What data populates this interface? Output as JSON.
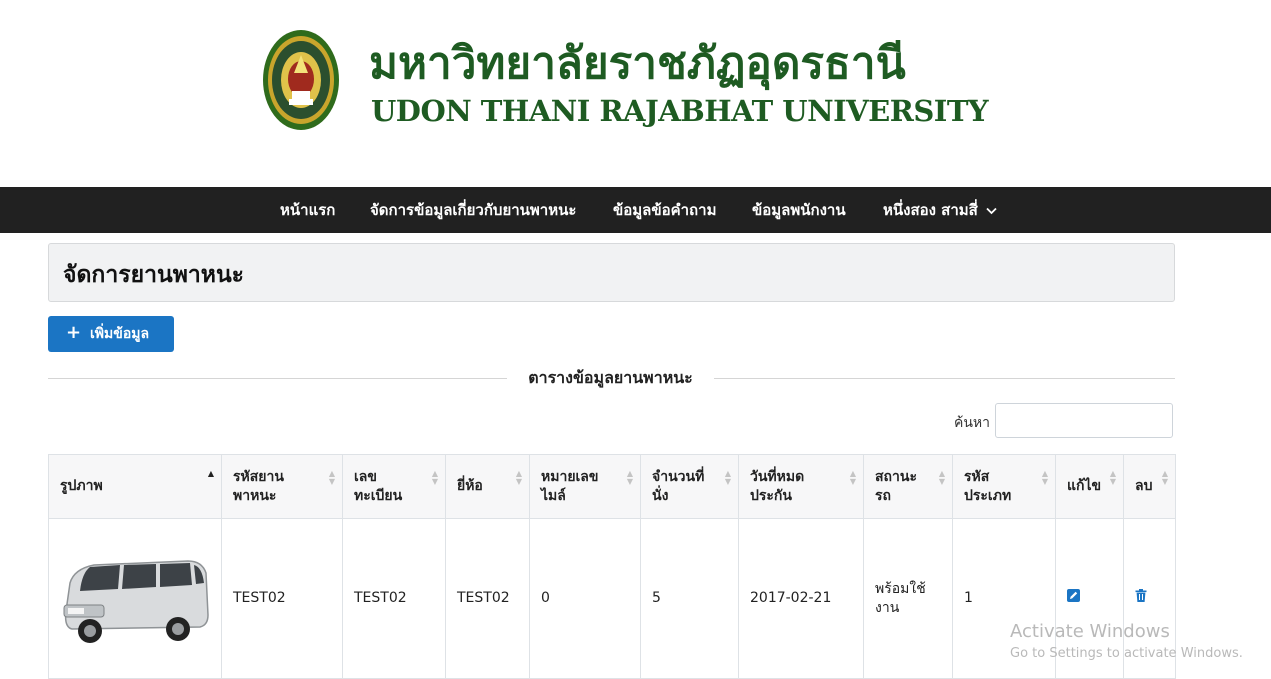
{
  "header": {
    "logo_text_thai": "มหาวิทยาลัยราชภัฏอุดรธานี",
    "logo_text_en": "UDON THANI RAJABHAT UNIVERSITY",
    "brand_color": "#1e5b22"
  },
  "nav": {
    "items": [
      {
        "label": "หน้าแรก"
      },
      {
        "label": "จัดการข้อมูลเกี่ยวกับยานพาหนะ"
      },
      {
        "label": "ข้อมูลข้อคำถาม"
      },
      {
        "label": "ข้อมูลพนักงาน"
      },
      {
        "label": "หนึ่งสอง สามสี่",
        "icon": "chevron-down-icon"
      }
    ],
    "background": "#212121"
  },
  "page": {
    "title": "จัดการยานพาหนะ",
    "add_button_label": "เพิ่มข้อมูล",
    "add_button_icon": "plus-icon",
    "section_title": "ตารางข้อมูลยานพาหนะ",
    "search_label": "ค้นหา",
    "search_value": "",
    "accent_color": "#1b75c4"
  },
  "table": {
    "columns": [
      "รูปภาพ",
      "รหัสยานพาหนะ",
      "เลขทะเบียน",
      "ยี่ห้อ",
      "หมายเลขไมล์",
      "จำนวนที่นั่ง",
      "วันที่หมดประกัน",
      "สถานะรถ",
      "รหัสประเภท",
      "แก้ไข",
      "ลบ"
    ],
    "rows": [
      {
        "image": "van-image",
        "vehicle_id": "TEST02",
        "plate": "TEST02",
        "brand": "TEST02",
        "mileage": "0",
        "seats": "5",
        "insurance_expiry": "2017-02-21",
        "status": "พร้อมใช้งาน",
        "type_id": "1",
        "edit_icon": "edit-icon",
        "delete_icon": "trash-icon"
      }
    ]
  },
  "watermark": {
    "title": "Activate Windows",
    "subtitle": "Go to Settings to activate Windows."
  }
}
